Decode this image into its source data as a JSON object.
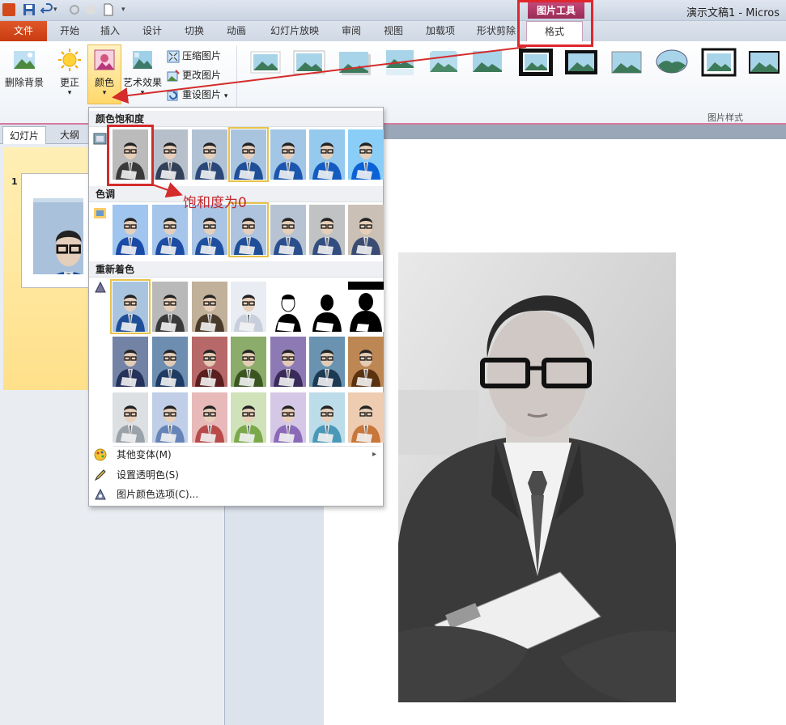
{
  "window": {
    "title": "演示文稿1 - Micros"
  },
  "contextual_tab": {
    "label": "图片工具"
  },
  "tabs": {
    "file": "文件",
    "home": "开始",
    "insert": "插入",
    "design": "设计",
    "transitions": "切换",
    "animations": "动画",
    "slideshow": "幻灯片放映",
    "review": "审阅",
    "view": "视图",
    "addins": "加载项",
    "shape_cut": "形状剪除",
    "format": "格式"
  },
  "ribbon": {
    "remove_bg": "删除背景",
    "corrections": "更正",
    "color": "颜色",
    "artistic": "艺术效果",
    "compress": "压缩图片",
    "change": "更改图片",
    "reset": "重设图片",
    "styles_group": "图片样式"
  },
  "left_pane": {
    "tab_slides": "幻灯片",
    "tab_outline": "大纲",
    "slide_number": "1"
  },
  "menu": {
    "saturation_header": "颜色饱和度",
    "tone_header": "色调",
    "recolor_header": "重新着色",
    "more_variants": "其他变体(M)",
    "set_transparent": "设置透明色(S)",
    "color_options": "图片颜色选项(C)..."
  },
  "annotation": {
    "text": "饱和度为0"
  },
  "icons": {
    "app": "powerpoint-icon",
    "save": "save-icon",
    "undo": "undo-icon",
    "color": "color-palette-icon",
    "corrections": "sun-icon",
    "remove_bg": "remove-background-icon",
    "artistic": "artistic-effects-icon",
    "compress": "compress-icon",
    "change": "change-picture-icon",
    "reset": "reset-picture-icon"
  },
  "colors": {
    "accent_pink": "#b03a6a",
    "highlight_red": "#d42b2b",
    "file_tab": "#d24a1c",
    "selection_gold": "#e7c24a"
  }
}
